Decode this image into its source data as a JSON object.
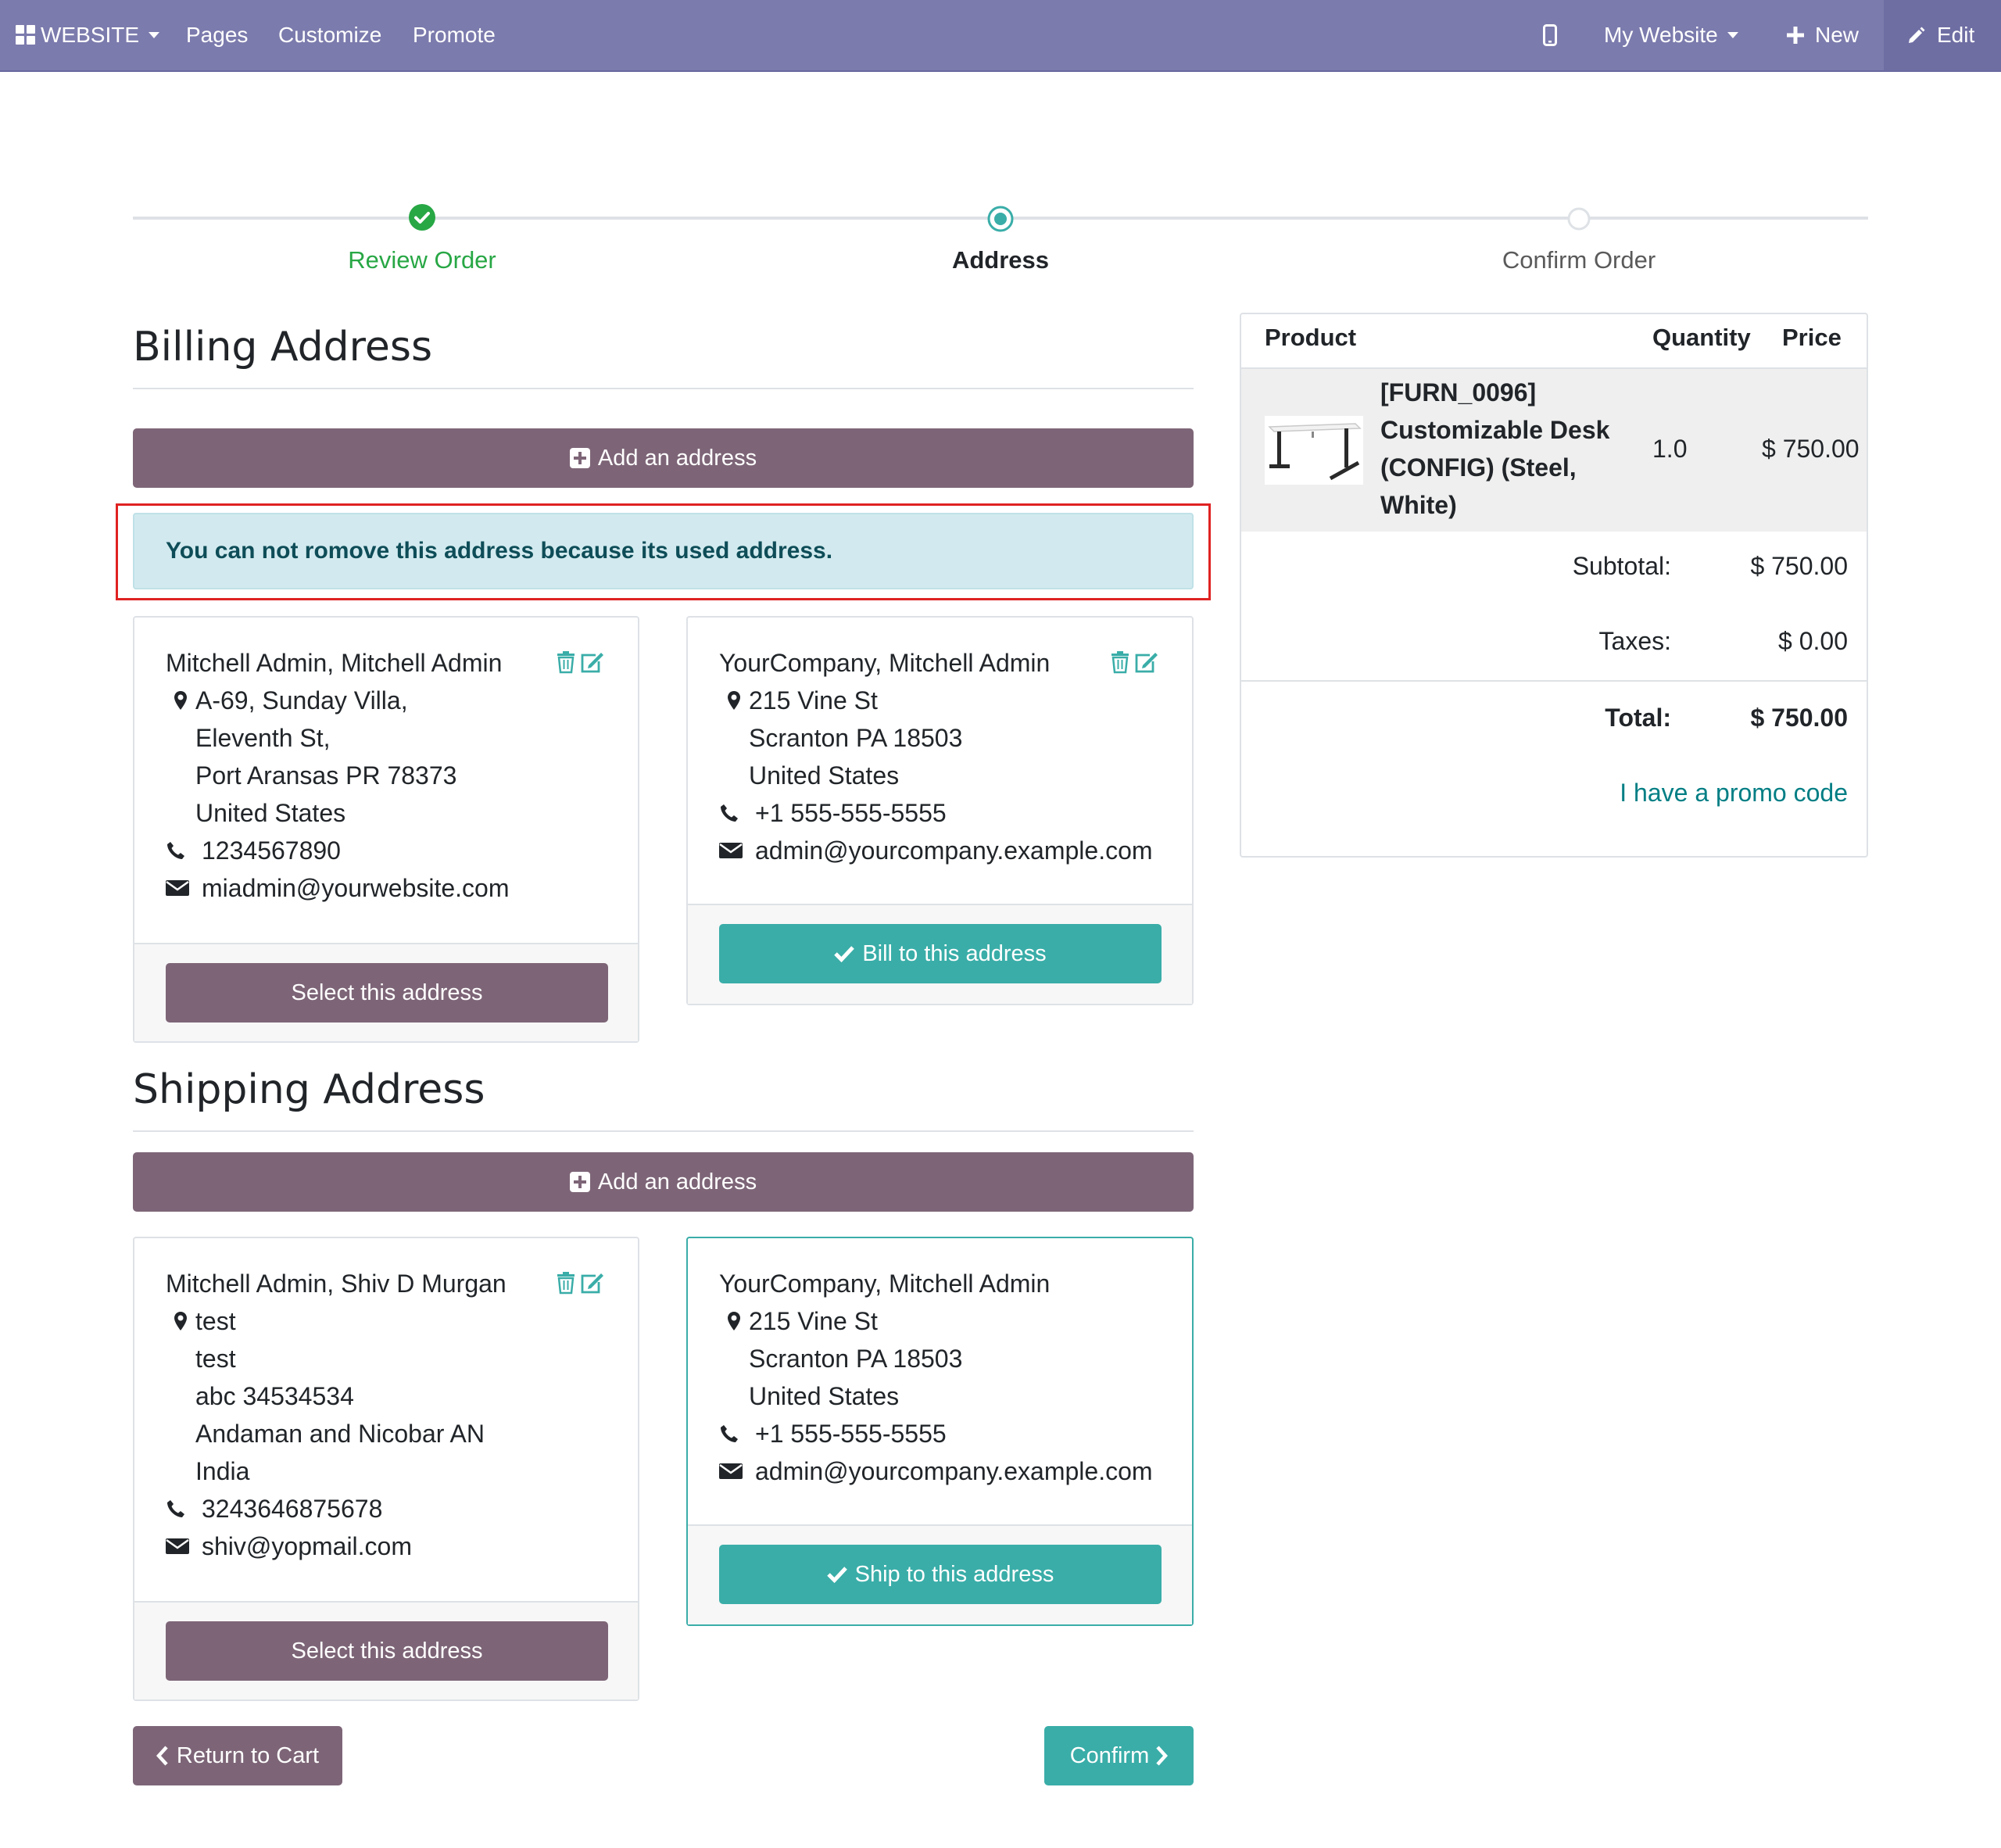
{
  "navbar": {
    "app_label": "WEBSITE",
    "menu": [
      "Pages",
      "Customize",
      "Promote"
    ],
    "site_selector": "My Website",
    "new_label": "New",
    "edit_label": "Edit"
  },
  "wizard": {
    "steps": [
      {
        "label": "Review Order",
        "state": "done"
      },
      {
        "label": "Address",
        "state": "active"
      },
      {
        "label": "Confirm Order",
        "state": "todo"
      }
    ]
  },
  "billing": {
    "title": "Billing Address",
    "add_label": "Add an address",
    "alert": "You can not romove this address because its used address.",
    "cards": [
      {
        "name": "Mitchell Admin, Mitchell Admin",
        "address": [
          "A-69, Sunday Villa,",
          "Eleventh St,",
          "Port Aransas PR 78373",
          "United States"
        ],
        "phone": "1234567890",
        "email": "miadmin@yourwebsite.com",
        "button": "Select this address",
        "selected": false
      },
      {
        "name": "YourCompany, Mitchell Admin",
        "address": [
          "215 Vine St",
          "Scranton PA 18503",
          "United States"
        ],
        "phone": "+1 555-555-5555",
        "email": "admin@yourcompany.example.com",
        "button": "Bill to this address",
        "selected": true
      }
    ]
  },
  "shipping": {
    "title": "Shipping Address",
    "add_label": "Add an address",
    "cards": [
      {
        "name": "Mitchell Admin, Shiv D Murgan",
        "address": [
          "test",
          "test",
          "abc 34534534",
          "Andaman and Nicobar AN",
          "India"
        ],
        "phone": "3243646875678",
        "email": "shiv@yopmail.com",
        "button": "Select this address",
        "selected": false
      },
      {
        "name": "YourCompany, Mitchell Admin",
        "address": [
          "215 Vine St",
          "Scranton PA 18503",
          "United States"
        ],
        "phone": "+1 555-555-5555",
        "email": "admin@yourcompany.example.com",
        "button": "Ship to this address",
        "selected": true
      }
    ]
  },
  "actions": {
    "return_label": "Return to Cart",
    "confirm_label": "Confirm"
  },
  "summary": {
    "headers": {
      "product": "Product",
      "quantity": "Quantity",
      "price": "Price"
    },
    "line": {
      "name_lines": [
        "[FURN_0096]",
        "Customizable Desk",
        "(CONFIG) (Steel,",
        "White)"
      ],
      "quantity": "1.0",
      "price": "$ 750.00"
    },
    "subtotal_label": "Subtotal:",
    "subtotal": "$ 750.00",
    "taxes_label": "Taxes:",
    "taxes": "$ 0.00",
    "total_label": "Total:",
    "total": "$ 750.00",
    "promo_label": "I have a promo code"
  },
  "colors": {
    "navbar": "#7c7bad",
    "primary": "#7d6577",
    "teal": "#3aada8",
    "success": "#28a745",
    "alert_bg": "#d2eaef",
    "alert_text": "#0e4d58"
  }
}
